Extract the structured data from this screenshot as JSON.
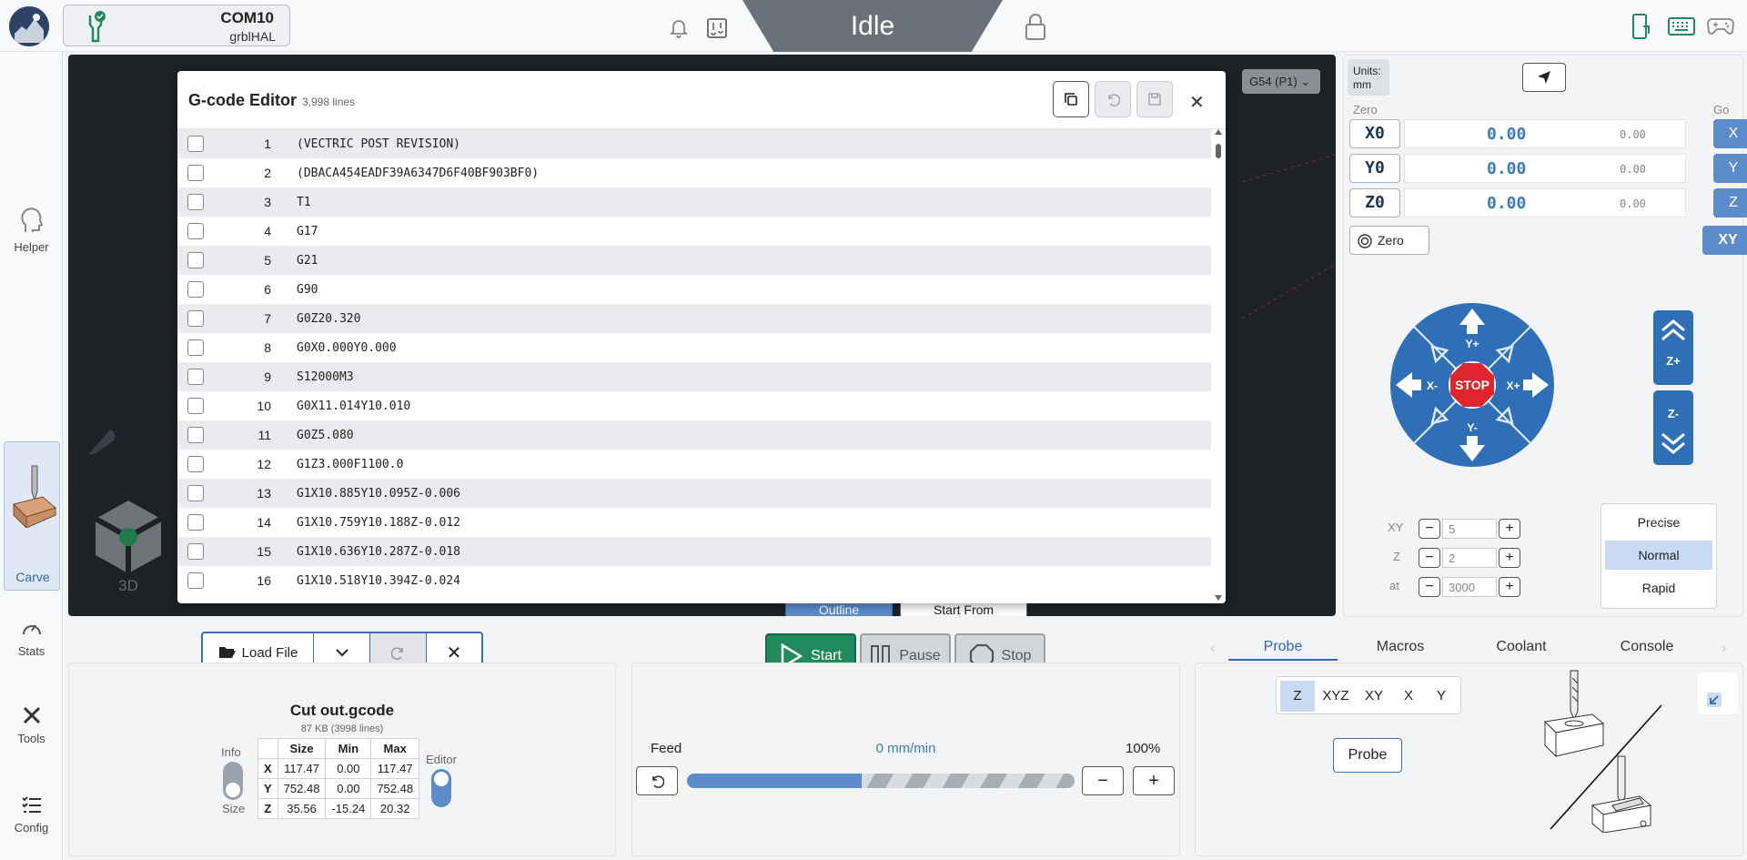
{
  "topbar": {
    "port": "COM10",
    "firmware": "grblHAL",
    "state": "Idle"
  },
  "sidebar": {
    "items": [
      {
        "label": "Helper"
      },
      {
        "label": "Carve"
      },
      {
        "label": "Stats"
      },
      {
        "label": "Tools"
      },
      {
        "label": "Config"
      }
    ]
  },
  "viewport": {
    "wcs": "G54 (P1)",
    "view_label": "3D",
    "outline_label": "Outline",
    "start_from_label": "Start From"
  },
  "editor": {
    "title": "G-code Editor",
    "line_count": "3,998 lines",
    "lines": [
      {
        "n": "1",
        "code": "(VECTRIC POST REVISION)"
      },
      {
        "n": "2",
        "code": "(DBACA454EADF39A6347D6F40BF903BF0)"
      },
      {
        "n": "3",
        "code": "T1"
      },
      {
        "n": "4",
        "code": "G17"
      },
      {
        "n": "5",
        "code": "G21"
      },
      {
        "n": "6",
        "code": "G90"
      },
      {
        "n": "7",
        "code": "G0Z20.320"
      },
      {
        "n": "8",
        "code": "G0X0.000Y0.000"
      },
      {
        "n": "9",
        "code": "S12000M3"
      },
      {
        "n": "10",
        "code": "G0X11.014Y10.010"
      },
      {
        "n": "11",
        "code": "G0Z5.080"
      },
      {
        "n": "12",
        "code": "G1Z3.000F1100.0"
      },
      {
        "n": "13",
        "code": "G1X10.885Y10.095Z-0.006"
      },
      {
        "n": "14",
        "code": "G1X10.759Y10.188Z-0.012"
      },
      {
        "n": "15",
        "code": "G1X10.636Y10.287Z-0.018"
      },
      {
        "n": "16",
        "code": "G1X10.518Y10.394Z-0.024"
      }
    ]
  },
  "dro": {
    "units_label": "Units:",
    "units": "mm",
    "zero_label": "Zero",
    "go_label": "Go",
    "axes": [
      {
        "zero": "X0",
        "value": "0.00",
        "mpos": "0.00",
        "go": "X"
      },
      {
        "zero": "Y0",
        "value": "0.00",
        "mpos": "0.00",
        "go": "Y"
      },
      {
        "zero": "Z0",
        "value": "0.00",
        "mpos": "0.00",
        "go": "Z"
      }
    ],
    "zero_all_label": "Zero",
    "go_xy_label": "XY"
  },
  "jog": {
    "stop": "STOP",
    "yplus": "Y+",
    "yminus": "Y-",
    "xplus": "X+",
    "xminus": "X-",
    "zplus": "Z+",
    "zminus": "Z-",
    "xy_label": "XY",
    "xy_step": "5",
    "z_label": "Z",
    "z_step": "2",
    "at_label": "at",
    "feed": "3000",
    "modes": [
      "Precise",
      "Normal",
      "Rapid"
    ],
    "active_mode": "Normal"
  },
  "file": {
    "load_label": "Load File",
    "name": "Cut out.gcode",
    "meta": "87 KB (3998 lines)",
    "info_label": "Info",
    "size_label": "Size",
    "editor_label": "Editor",
    "table": {
      "headers": [
        "",
        "Size",
        "Min",
        "Max"
      ],
      "rows": [
        [
          "X",
          "117.47",
          "0.00",
          "117.47"
        ],
        [
          "Y",
          "752.48",
          "0.00",
          "752.48"
        ],
        [
          "Z",
          "35.56",
          "-15.24",
          "20.32"
        ]
      ]
    }
  },
  "job": {
    "start": "Start",
    "pause": "Pause",
    "stop": "Stop",
    "feed_label": "Feed",
    "feed_rate": "0 mm/min",
    "feed_pct": "100%",
    "override_fraction": 0.45
  },
  "tools": {
    "tabs": [
      "Probe",
      "Macros",
      "Coolant",
      "Console"
    ],
    "active_tab": "Probe",
    "probe_axes": [
      "Z",
      "XYZ",
      "XY",
      "X",
      "Y"
    ],
    "active_axis": "Z",
    "probe_button": "Probe"
  },
  "colors": {
    "accent": "#3b7bc4",
    "start": "#1f8a5b",
    "stop_red": "#e0252f"
  }
}
